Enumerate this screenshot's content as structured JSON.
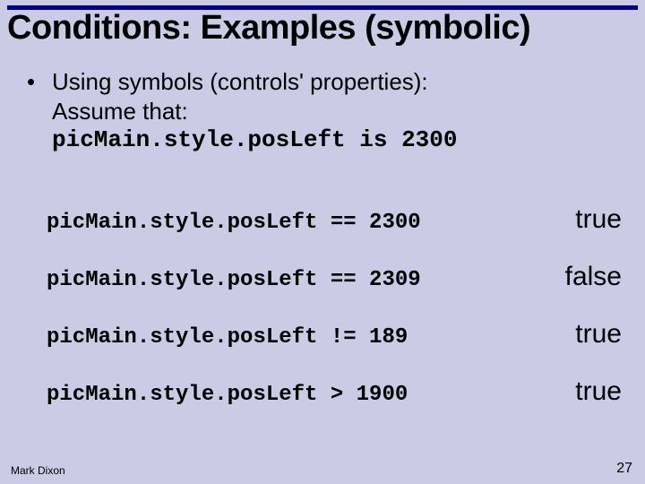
{
  "title": "Conditions: Examples (symbolic)",
  "bullet": {
    "symbol": "•",
    "intro": "Using symbols (controls' properties):",
    "assume": "Assume that:",
    "premise": "picMain.style.posLeft is 2300"
  },
  "examples": [
    {
      "expr": "picMain.style.posLeft == 2300",
      "result": "true"
    },
    {
      "expr": "picMain.style.posLeft == 2309",
      "result": "false"
    },
    {
      "expr": "picMain.style.posLeft != 189",
      "result": "true"
    },
    {
      "expr": "picMain.style.posLeft > 1900",
      "result": "true"
    }
  ],
  "footer": {
    "author": "Mark Dixon",
    "page": "27"
  }
}
